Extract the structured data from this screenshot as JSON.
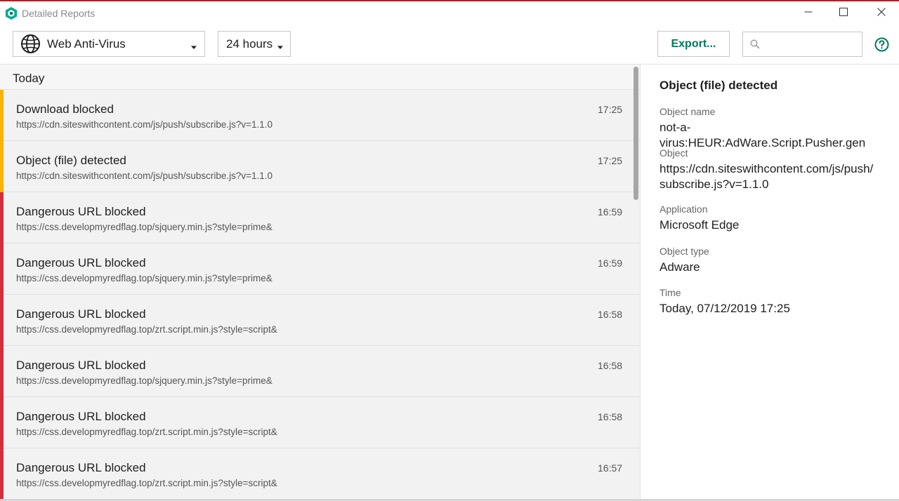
{
  "window": {
    "title": "Detailed Reports",
    "controls": {
      "minimize": "minimize-icon",
      "maximize": "maximize-icon",
      "close": "close-icon"
    }
  },
  "toolbar": {
    "category": {
      "value": "Web Anti-Virus",
      "icon": "globe-icon"
    },
    "period": {
      "value": "24 hours"
    },
    "export_label": "Export...",
    "search": {
      "value": "",
      "placeholder": ""
    },
    "help_icon": "help-icon"
  },
  "list": {
    "group_label": "Today",
    "rows": [
      {
        "title": "Download blocked",
        "url": "https://cdn.siteswithcontent.com/js/push/subscribe.js?v=1.1.0",
        "time": "17:25",
        "severity": "warning"
      },
      {
        "title": "Object (file) detected",
        "url": "https://cdn.siteswithcontent.com/js/push/subscribe.js?v=1.1.0",
        "time": "17:25",
        "severity": "warning"
      },
      {
        "title": "Dangerous URL blocked",
        "url": "https://css.developmyredflag.top/sjquery.min.js?style=prime&",
        "time": "16:59",
        "severity": "critical"
      },
      {
        "title": "Dangerous URL blocked",
        "url": "https://css.developmyredflag.top/sjquery.min.js?style=prime&",
        "time": "16:59",
        "severity": "critical"
      },
      {
        "title": "Dangerous URL blocked",
        "url": "https://css.developmyredflag.top/zrt.script.min.js?style=script&",
        "time": "16:58",
        "severity": "critical"
      },
      {
        "title": "Dangerous URL blocked",
        "url": "https://css.developmyredflag.top/sjquery.min.js?style=prime&",
        "time": "16:58",
        "severity": "critical"
      },
      {
        "title": "Dangerous URL blocked",
        "url": "https://css.developmyredflag.top/zrt.script.min.js?style=script&",
        "time": "16:58",
        "severity": "critical"
      },
      {
        "title": "Dangerous URL blocked",
        "url": "https://css.developmyredflag.top/zrt.script.min.js?style=script&",
        "time": "16:57",
        "severity": "critical"
      }
    ]
  },
  "details": {
    "title": "Object (file) detected",
    "fields": [
      {
        "label": "Object name",
        "value": "not-a-virus:HEUR:AdWare.Script.Pusher.gen"
      },
      {
        "label": "Object",
        "value": "https://cdn.siteswithcontent.com/js/push/\nsubscribe.js?v=1.1.0"
      },
      {
        "label": "Application",
        "value": "Microsoft Edge"
      },
      {
        "label": "Object type",
        "value": "Adware"
      },
      {
        "label": "Time",
        "value": "Today, 07/12/2019 17:25"
      }
    ]
  },
  "colors": {
    "accent": "#00795c",
    "severity_warning": "#f8b400",
    "severity_critical": "#d12f3c",
    "window_border": "#a4262c"
  }
}
